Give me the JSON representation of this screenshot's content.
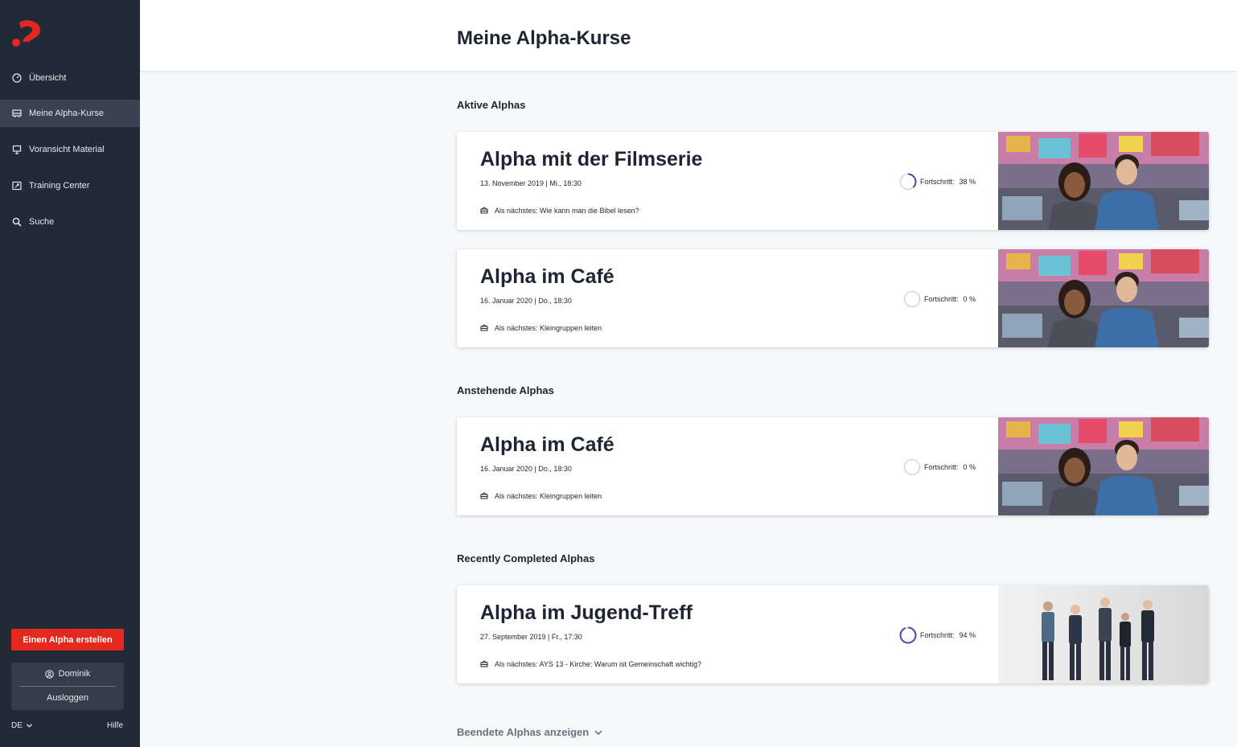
{
  "sidebar": {
    "nav": [
      {
        "label": "Übersicht",
        "icon": "dashboard-icon"
      },
      {
        "label": "Meine Alpha-Kurse",
        "icon": "course-icon",
        "active": true
      },
      {
        "label": "Voransicht Material",
        "icon": "presentation-icon"
      },
      {
        "label": "Training Center",
        "icon": "training-icon"
      },
      {
        "label": "Suche",
        "icon": "search-icon"
      }
    ],
    "create_button": "Einen Alpha erstellen",
    "user_name": "Dominik",
    "logout": "Ausloggen",
    "language": "DE",
    "help": "Hilfe"
  },
  "header": {
    "title": "Meine Alpha-Kurse"
  },
  "sections": {
    "active": "Aktive Alphas",
    "upcoming": "Anstehende Alphas",
    "completed": "Recently Completed Alphas"
  },
  "cards": [
    {
      "title": "Alpha mit der Filmserie",
      "date": "13. November 2019 | Mi., 18:30",
      "progress_label": "Fortschritt:",
      "progress_text": "38 %",
      "progress": 0.38,
      "next": "Als nächstes: Wie kann man die Bibel lesen?"
    },
    {
      "title": "Alpha im Café",
      "date": "16. Januar 2020 | Do., 18:30",
      "progress_label": "Fortschritt:",
      "progress_text": "0 %",
      "progress": 0.0,
      "next": "Als nächstes: Kleingruppen leiten"
    },
    {
      "title": "Alpha im Café",
      "date": "16. Januar 2020 | Do., 18:30",
      "progress_label": "Fortschritt:",
      "progress_text": "0 %",
      "progress": 0.0,
      "next": "Als nächstes: Kleingruppen leiten"
    },
    {
      "title": "Alpha im Jugend-Treff",
      "date": "27. September 2019 | Fr., 17:30",
      "progress_label": "Fortschritt:",
      "progress_text": "94 %",
      "progress": 0.94,
      "next": "Als nächstes: AYS 13 - Kirche: Warum ist Gemeinschaft wichtig?"
    }
  ],
  "show_ended": "Beendete Alphas anzeigen",
  "colors": {
    "sidebar": "#222a38",
    "accent_red": "#e4271f",
    "progress": "#4b44a8"
  }
}
